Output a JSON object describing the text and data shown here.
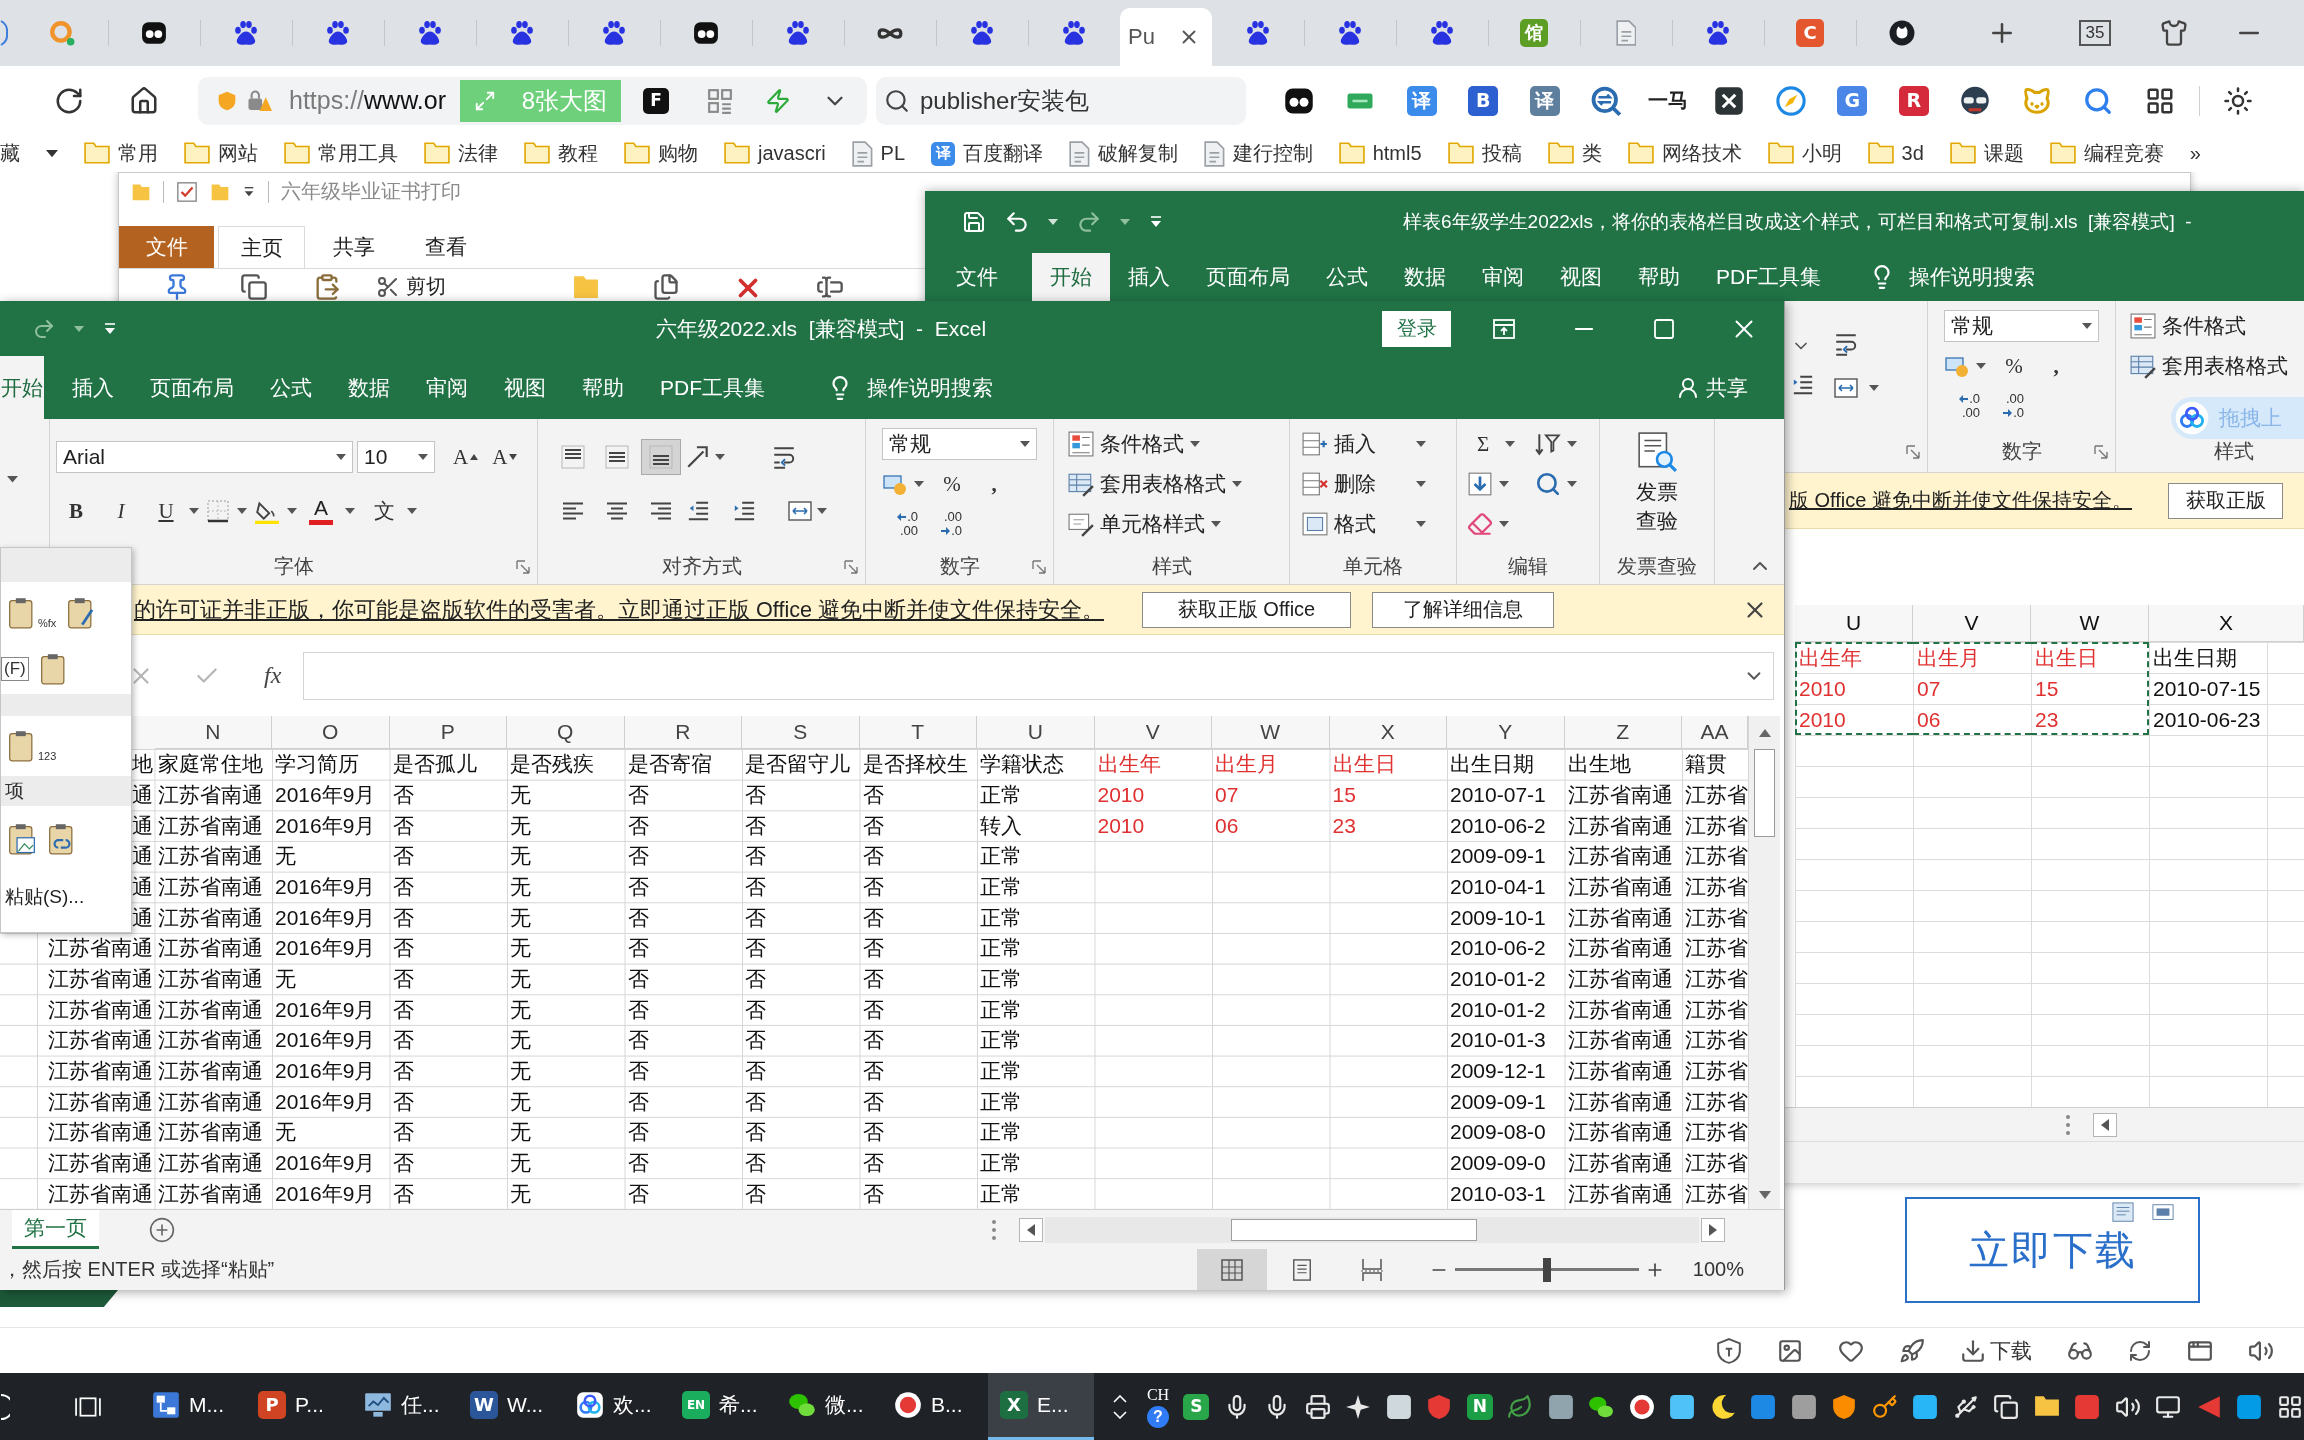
{
  "browser": {
    "tabs": [
      {
        "kind": "ring",
        "selected": false
      },
      {
        "kind": "eyes",
        "selected": false
      },
      {
        "kind": "paw",
        "selected": false
      },
      {
        "kind": "paw",
        "selected": false
      },
      {
        "kind": "paw",
        "selected": false
      },
      {
        "kind": "paw",
        "selected": false
      },
      {
        "kind": "paw",
        "selected": false
      },
      {
        "kind": "eyes",
        "selected": false
      },
      {
        "kind": "paw",
        "selected": false
      },
      {
        "kind": "infinity",
        "selected": false
      },
      {
        "kind": "paw",
        "selected": false
      },
      {
        "kind": "paw",
        "selected": false
      },
      {
        "kind": "title",
        "label": "Pu",
        "selected": true
      },
      {
        "kind": "paw",
        "selected": false
      },
      {
        "kind": "paw",
        "selected": false
      },
      {
        "kind": "paw",
        "selected": false
      },
      {
        "kind": "letter",
        "glyph": "馆",
        "color": "#5c9e24",
        "selected": false
      },
      {
        "kind": "doc",
        "selected": false
      },
      {
        "kind": "paw",
        "selected": false
      },
      {
        "kind": "letter",
        "glyph": "C",
        "color": "#e4572e",
        "selected": false
      },
      {
        "kind": "round-logo",
        "selected": false
      }
    ],
    "tab_count": "35",
    "address": {
      "scheme": "https://",
      "host": "www.or",
      "big_images": "8张大图",
      "tools": [
        {
          "kind": "letter",
          "glyph": "F",
          "color": "#111111"
        },
        {
          "kind": "qr"
        },
        {
          "kind": "bolt"
        },
        {
          "kind": "chevron"
        }
      ]
    },
    "search": {
      "value": "publisher安装包"
    },
    "extensions": [
      {
        "kind": "eyes"
      },
      {
        "kind": "chat"
      },
      {
        "kind": "letter",
        "glyph": "译",
        "color": "#3b8beb"
      },
      {
        "kind": "letter",
        "glyph": "B",
        "color": "#2c5fcf"
      },
      {
        "kind": "letter",
        "glyph": "译",
        "color": "#5f7f9f"
      },
      {
        "kind": "q-chat"
      },
      {
        "kind": "text",
        "label": "一马"
      },
      {
        "kind": "x-tile"
      },
      {
        "kind": "compass"
      },
      {
        "kind": "letter",
        "glyph": "G",
        "color": "#4a86e8"
      },
      {
        "kind": "letter",
        "glyph": "R",
        "color": "#d42a3c"
      },
      {
        "kind": "spy"
      },
      {
        "kind": "cat"
      },
      {
        "kind": "magnifier"
      },
      {
        "kind": "grid"
      }
    ],
    "bookmarks": {
      "items": [
        {
          "kind": "text",
          "label": "藏"
        },
        {
          "kind": "caret"
        },
        {
          "kind": "folder",
          "label": "常用"
        },
        {
          "kind": "folder",
          "label": "网站"
        },
        {
          "kind": "folder",
          "label": "常用工具"
        },
        {
          "kind": "folder",
          "label": "法律"
        },
        {
          "kind": "folder",
          "label": "教程"
        },
        {
          "kind": "folder",
          "label": "购物"
        },
        {
          "kind": "folder",
          "label": "javascri"
        },
        {
          "kind": "doc",
          "label": "PL"
        },
        {
          "kind": "letter",
          "glyph": "译",
          "color": "#3b8beb",
          "label": "百度翻译"
        },
        {
          "kind": "doc",
          "label": "破解复制"
        },
        {
          "kind": "doc",
          "label": "建行控制"
        },
        {
          "kind": "folder",
          "label": "html5"
        },
        {
          "kind": "folder",
          "label": "投稿"
        },
        {
          "kind": "folder",
          "label": "类"
        },
        {
          "kind": "folder",
          "label": "网络技术"
        },
        {
          "kind": "folder",
          "label": "小明"
        },
        {
          "kind": "folder",
          "label": "3d"
        },
        {
          "kind": "folder",
          "label": "课题"
        },
        {
          "kind": "folder",
          "label": "编程竞赛"
        }
      ],
      "more": "»"
    }
  },
  "explorer": {
    "title": "六年级毕业证书打印",
    "tabs": [
      {
        "kind": "file",
        "label": "文件",
        "selected": false
      },
      {
        "kind": "tab",
        "label": "主页",
        "selected": true
      },
      {
        "kind": "tab",
        "label": "共享",
        "selected": false
      },
      {
        "kind": "tab",
        "label": "查看",
        "selected": false
      }
    ],
    "cut": "剪切"
  },
  "back_workbook": {
    "title": "样表6年级学生2022xls，将你的表格栏目改成这个样式，可栏目和格式可复制.xls  [兼容模式]  -",
    "tabs": [
      {
        "label": "文件",
        "selected": false
      },
      {
        "label": "开始",
        "selected": true
      },
      {
        "label": "插入",
        "selected": false
      },
      {
        "label": "页面布局",
        "selected": false
      },
      {
        "label": "公式",
        "selected": false
      },
      {
        "label": "数据",
        "selected": false
      },
      {
        "label": "审阅",
        "selected": false
      },
      {
        "label": "视图",
        "selected": false
      },
      {
        "label": "帮助",
        "selected": false
      },
      {
        "label": "PDF工具集",
        "selected": false
      }
    ],
    "tell_me": "操作说明搜索",
    "ribbon": {
      "number": {
        "label": "数字",
        "format": "常规",
        "percent": "%",
        "comma": ",",
        "more_decimals": [
          ".0",
          ".00"
        ],
        "fewer_decimals": [
          ".00",
          ".0"
        ]
      },
      "styles": {
        "label": "样式",
        "items": [
          {
            "kind": "conditional",
            "label": "条件格式"
          },
          {
            "kind": "table",
            "label": "套用表格格式"
          }
        ]
      }
    },
    "cloud_widget": "拖拽上",
    "license_bar": {
      "message": "版 Office 避免中断并使文件保持安全。",
      "button": "获取正版"
    },
    "sheet": {
      "columns": [
        {
          "label": "U",
          "color": "#e03131",
          "copied": true
        },
        {
          "label": "V",
          "color": "#e03131",
          "copied": true
        },
        {
          "label": "W",
          "color": "#e03131",
          "copied": true
        },
        {
          "label": "X",
          "copied": false
        }
      ],
      "rows": [
        [
          "出生年",
          "出生月",
          "出生日",
          "出生日期"
        ],
        [
          "2010",
          "07",
          "15",
          "2010-07-15"
        ],
        [
          "2010",
          "06",
          "23",
          "2010-06-23"
        ]
      ]
    }
  },
  "workbook": {
    "title": "六年级2022.xls  [兼容模式]  -  Excel",
    "sign_in": "登录",
    "tabs": [
      {
        "label": "开始",
        "selected": true
      },
      {
        "label": "插入",
        "selected": false
      },
      {
        "label": "页面布局",
        "selected": false
      },
      {
        "label": "公式",
        "selected": false
      },
      {
        "label": "数据",
        "selected": false
      },
      {
        "label": "审阅",
        "selected": false
      },
      {
        "label": "视图",
        "selected": false
      },
      {
        "label": "帮助",
        "selected": false
      },
      {
        "label": "PDF工具集",
        "selected": false
      }
    ],
    "tell_me": "操作说明搜索",
    "share": "共享",
    "ribbon": {
      "font": {
        "label": "字体",
        "name": "Arial",
        "size": "10",
        "grow": "A",
        "shrink": "A",
        "bold": "B",
        "italic": "I",
        "underline": "U",
        "color_glyph": "A",
        "phonetic": "文"
      },
      "alignment": {
        "label": "对齐方式",
        "vertical": [
          {
            "kind": "top",
            "selected": false
          },
          {
            "kind": "middle",
            "selected": false
          },
          {
            "kind": "bottom",
            "selected": true
          }
        ],
        "horizontal": [
          {
            "kind": "left",
            "selected": false
          },
          {
            "kind": "center",
            "selected": false
          },
          {
            "kind": "right",
            "selected": false
          }
        ]
      },
      "number": {
        "label": "数字",
        "format": "常规",
        "percent": "%",
        "comma": ",",
        "more_decimals": [
          ".0",
          ".00"
        ],
        "fewer_decimals": [
          ".00",
          ".0"
        ]
      },
      "styles": {
        "label": "样式",
        "items": [
          {
            "kind": "conditional",
            "label": "条件格式"
          },
          {
            "kind": "table",
            "label": "套用表格格式"
          },
          {
            "kind": "cell",
            "label": "单元格样式"
          }
        ]
      },
      "cells": {
        "label": "单元格",
        "items": [
          {
            "kind": "insert",
            "label": "插入"
          },
          {
            "kind": "delete",
            "label": "删除"
          },
          {
            "kind": "format",
            "label": "格式"
          }
        ]
      },
      "editing": {
        "label": "编辑",
        "sum": "Σ"
      },
      "invoice": {
        "label": "发票查验",
        "button": "发票查验"
      }
    },
    "license_bar": {
      "message": "的许可证并非正版，你可能是盗版软件的受害者。立即通过正版 Office 避免中断并使文件保持安全。",
      "buttons": [
        "获取正版 Office",
        "了解详细信息"
      ]
    },
    "formula_bar": {
      "fx": "fx"
    },
    "sheet": {
      "columns": [
        {},
        {
          "label": "N"
        },
        {
          "label": "O"
        },
        {
          "label": "P"
        },
        {
          "label": "Q"
        },
        {
          "label": "R"
        },
        {
          "label": "S"
        },
        {
          "label": "T"
        },
        {
          "label": "U"
        },
        {
          "label": "V",
          "color": "#e03131"
        },
        {
          "label": "W",
          "color": "#e03131"
        },
        {
          "label": "X",
          "color": "#e03131"
        },
        {
          "label": "Y"
        },
        {
          "label": "Z"
        },
        {
          "label": "AA"
        }
      ],
      "rows": [
        [
          "地",
          "家庭常住地",
          "学习简历",
          "是否孤儿",
          "是否残疾",
          "是否寄宿",
          "是否留守儿",
          "是否择校生",
          "学籍状态",
          "出生年",
          "出生月",
          "出生日",
          "出生日期",
          "出生地",
          "籍贯"
        ],
        [
          "通",
          "江苏省南通",
          "2016年9月",
          "否",
          "无",
          "否",
          "否",
          "否",
          "正常",
          "2010",
          "07",
          "15",
          "2010-07-1",
          "江苏省南通",
          "江苏省"
        ],
        [
          "通",
          "江苏省南通",
          "2016年9月",
          "否",
          "无",
          "否",
          "否",
          "否",
          "转入",
          "2010",
          "06",
          "23",
          "2010-06-2",
          "江苏省南通",
          "江苏省"
        ],
        [
          "通",
          "江苏省南通",
          "无",
          "否",
          "无",
          "否",
          "否",
          "否",
          "正常",
          null,
          null,
          null,
          "2009-09-1",
          "江苏省南通",
          "江苏省"
        ],
        [
          "通",
          "江苏省南通",
          "2016年9月",
          "否",
          "无",
          "否",
          "否",
          "否",
          "正常",
          null,
          null,
          null,
          "2010-04-1",
          "江苏省南通",
          "江苏省"
        ],
        [
          "通",
          "江苏省南通",
          "2016年9月",
          "否",
          "无",
          "否",
          "否",
          "否",
          "正常",
          null,
          null,
          null,
          "2009-10-1",
          "江苏省南通",
          "江苏省"
        ],
        [
          "江苏省南通",
          "江苏省南通",
          "2016年9月",
          "否",
          "无",
          "否",
          "否",
          "否",
          "正常",
          null,
          null,
          null,
          "2010-06-2",
          "江苏省南通",
          "江苏省"
        ],
        [
          "江苏省南通",
          "江苏省南通",
          "无",
          "否",
          "无",
          "否",
          "否",
          "否",
          "正常",
          null,
          null,
          null,
          "2010-01-2",
          "江苏省南通",
          "江苏省"
        ],
        [
          "江苏省南通",
          "江苏省南通",
          "2016年9月",
          "否",
          "无",
          "否",
          "否",
          "否",
          "正常",
          null,
          null,
          null,
          "2010-01-2",
          "江苏省南通",
          "江苏省"
        ],
        [
          "江苏省南通",
          "江苏省南通",
          "2016年9月",
          "否",
          "无",
          "否",
          "否",
          "否",
          "正常",
          null,
          null,
          null,
          "2010-01-3",
          "江苏省南通",
          "江苏省"
        ],
        [
          "江苏省南通",
          "江苏省南通",
          "2016年9月",
          "否",
          "无",
          "否",
          "否",
          "否",
          "正常",
          null,
          null,
          null,
          "2009-12-1",
          "江苏省南通",
          "江苏省"
        ],
        [
          "江苏省南通",
          "江苏省南通",
          "2016年9月",
          "否",
          "无",
          "否",
          "否",
          "否",
          "正常",
          null,
          null,
          null,
          "2009-09-1",
          "江苏省南通",
          "江苏省"
        ],
        [
          "江苏省南通",
          "江苏省南通",
          "无",
          "否",
          "无",
          "否",
          "否",
          "否",
          "正常",
          null,
          null,
          null,
          "2009-08-0",
          "江苏省南通",
          "江苏省"
        ],
        [
          "江苏省南通",
          "江苏省南通",
          "2016年9月",
          "否",
          "无",
          "否",
          "否",
          "否",
          "正常",
          null,
          null,
          null,
          "2009-09-0",
          "江苏省南通",
          "江苏省"
        ],
        [
          "江苏省南通",
          "江苏省南通",
          "2016年9月",
          "否",
          "无",
          "否",
          "否",
          "否",
          "正常",
          null,
          null,
          null,
          "2010-03-1",
          "江苏省南通",
          "江苏省"
        ]
      ]
    },
    "sheet_tabs": [
      {
        "label": "第一页",
        "selected": true
      }
    ],
    "status": {
      "message": "，然后按 ENTER 或选择“粘贴”",
      "views": [
        {
          "kind": "normal",
          "selected": true
        },
        {
          "kind": "page-layout",
          "selected": false
        },
        {
          "kind": "page-break",
          "selected": false
        }
      ],
      "zoom": {
        "level": 0.5,
        "reading": "100%"
      }
    },
    "paste_menu": {
      "options": [
        {
          "kind": "formulas",
          "glyph": "%fx"
        },
        {
          "kind": "formatting"
        }
      ],
      "hint": "(F)",
      "values": {
        "kind": "values",
        "glyph": "123"
      },
      "section": "项",
      "picture_options": [
        {
          "kind": "picture"
        },
        {
          "kind": "linked-picture"
        }
      ],
      "special": "粘贴(S)..."
    }
  },
  "page": {
    "download_button": "立即下载"
  },
  "browser_status": {
    "download": "下载"
  },
  "taskbar": {
    "apps": [
      {
        "kind": "diagram",
        "label": "M...",
        "selected": false
      },
      {
        "kind": "letter",
        "glyph": "P",
        "color": "#d04423",
        "label": "P...",
        "selected": false
      },
      {
        "kind": "chart-monitor",
        "label": "任...",
        "selected": false
      },
      {
        "kind": "letter",
        "glyph": "W",
        "color": "#2b579a",
        "label": "W...",
        "selected": false
      },
      {
        "kind": "rings",
        "label": "欢...",
        "selected": false
      },
      {
        "kind": "letter",
        "glyph": "EN",
        "color": "#1aad5e",
        "label": "希...",
        "selected": false
      },
      {
        "kind": "chat-bubbles",
        "label": "微...",
        "selected": false
      },
      {
        "kind": "record",
        "label": "B...",
        "selected": false
      },
      {
        "kind": "letter",
        "glyph": "X",
        "color": "#1d6f42",
        "label": "E...",
        "selected": true
      }
    ],
    "language": "CH",
    "help": "?",
    "tray": [
      {
        "kind": "letter",
        "glyph": "S",
        "color": "#2aa64a"
      },
      {
        "kind": "mic"
      },
      {
        "kind": "mic"
      },
      {
        "kind": "printer"
      },
      {
        "kind": "sparkle"
      },
      {
        "kind": "tile",
        "color": "#cfd8dc"
      },
      {
        "kind": "shield",
        "color": "#e53935"
      },
      {
        "kind": "letter",
        "glyph": "N",
        "color": "#1b9e46"
      },
      {
        "kind": "leaf"
      },
      {
        "kind": "tile",
        "color": "#90a4ae"
      },
      {
        "kind": "chat-bubbles"
      },
      {
        "kind": "record"
      },
      {
        "kind": "tile",
        "color": "#4fc3f7"
      },
      {
        "kind": "moon"
      },
      {
        "kind": "tile",
        "color": "#1e88e5"
      },
      {
        "kind": "tile",
        "color": "#9e9e9e"
      },
      {
        "kind": "shield",
        "color": "#fb8c00"
      },
      {
        "kind": "key"
      },
      {
        "kind": "tile",
        "color": "#29b6f6"
      },
      {
        "kind": "usb"
      },
      {
        "kind": "copy"
      },
      {
        "kind": "folder-filled"
      },
      {
        "kind": "tile",
        "color": "#e53935"
      },
      {
        "kind": "speaker"
      },
      {
        "kind": "monitor"
      },
      {
        "kind": "triangle"
      },
      {
        "kind": "tile",
        "color": "#039be5"
      },
      {
        "kind": "grid"
      }
    ]
  }
}
